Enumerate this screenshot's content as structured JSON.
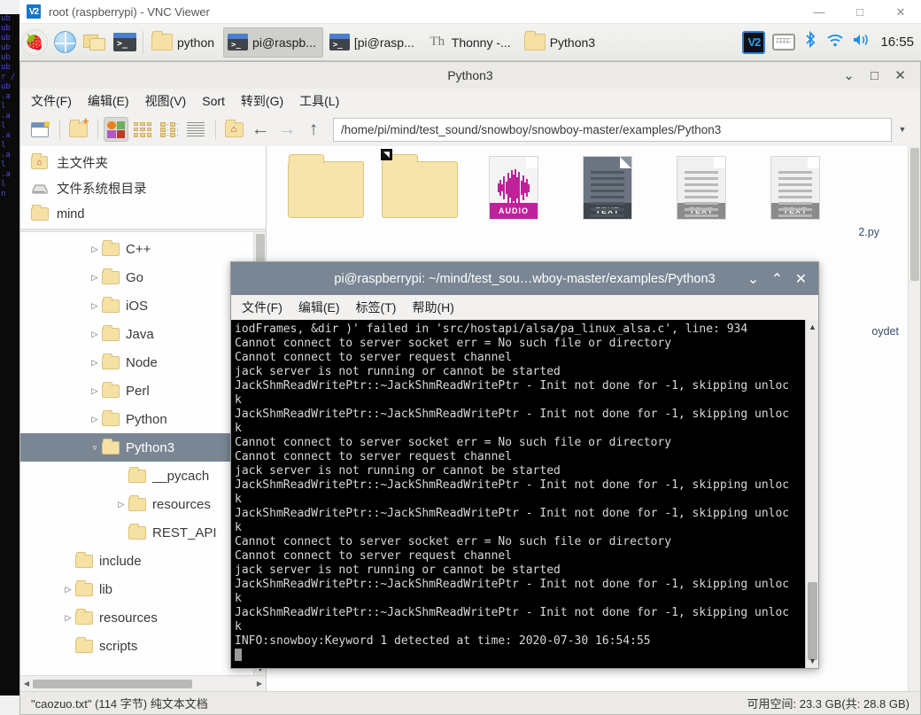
{
  "vnc": {
    "title": "root (raspberrypi) - VNC Viewer",
    "logo": "V2",
    "controls": {
      "minimize": "—",
      "maximize": "□",
      "close": "✕"
    },
    "control_names": [
      "minimize-icon",
      "maximize-icon",
      "close-icon"
    ]
  },
  "taskbar": {
    "launchers": [
      "raspberry-menu-icon",
      "web-browser-icon",
      "file-manager-icon",
      "terminal-icon"
    ],
    "raspberry_glyph": "🍓",
    "terminal_prompt": ">_",
    "tasks": [
      {
        "label": "python",
        "icon": "folder-icon",
        "active": false
      },
      {
        "label": "pi@raspb...",
        "icon": "terminal-icon",
        "active": true
      },
      {
        "label": "[pi@rasp...",
        "icon": "terminal-icon",
        "active": false
      },
      {
        "label": "Thonny -...",
        "icon": "thonny-icon",
        "active": false
      },
      {
        "label": "Python3",
        "icon": "folder-icon",
        "active": false
      }
    ],
    "thonny_glyph": "Th",
    "tray": {
      "vnc": "V2",
      "keyboard": "keyboard-icon",
      "bluetooth": "✱",
      "wifi": "wifi-icon",
      "volume": "volume-icon",
      "clock": "16:55"
    },
    "accent_blue": "#1e90e8"
  },
  "file_manager": {
    "title": "Python3",
    "controls": {
      "shade": "⌄",
      "maximize": "□",
      "close": "✕"
    },
    "menus": [
      "文件(F)",
      "编辑(E)",
      "视图(V)",
      "Sort",
      "转到(G)",
      "工具(L)"
    ],
    "toolbar": {
      "new_tab": "new-tab-icon",
      "new_folder": "new-folder-icon",
      "view_mode_icons": "icon-view-icon",
      "thumbnail_view": "thumbnail-view-icon",
      "compact_view": "compact-view-icon",
      "detailed_view": "detailed-list-view-icon",
      "home": "home-folder-icon",
      "back": "←",
      "forward": "→",
      "up": "↑",
      "dropdown": "▼"
    },
    "path": "/home/pi/mind/test_sound/snowboy/snowboy-master/examples/Python3",
    "places": [
      {
        "label": "主文件夹",
        "icon": "home-icon"
      },
      {
        "label": "文件系统根目录",
        "icon": "drive-icon"
      },
      {
        "label": "mind",
        "icon": "folder-icon"
      }
    ],
    "tree": [
      {
        "label": "C++",
        "indent": 2,
        "twisty": "▷",
        "selected": false
      },
      {
        "label": "Go",
        "indent": 2,
        "twisty": "▷",
        "selected": false
      },
      {
        "label": "iOS",
        "indent": 2,
        "twisty": "▷",
        "selected": false
      },
      {
        "label": "Java",
        "indent": 2,
        "twisty": "▷",
        "selected": false
      },
      {
        "label": "Node",
        "indent": 2,
        "twisty": "▷",
        "selected": false
      },
      {
        "label": "Perl",
        "indent": 2,
        "twisty": "▷",
        "selected": false
      },
      {
        "label": "Python",
        "indent": 2,
        "twisty": "▷",
        "selected": false
      },
      {
        "label": "Python3",
        "indent": 2,
        "twisty": "▿",
        "selected": true
      },
      {
        "label": "__pycach",
        "indent": 3,
        "twisty": "",
        "selected": false
      },
      {
        "label": "resources",
        "indent": 3,
        "twisty": "▷",
        "selected": false
      },
      {
        "label": "REST_API",
        "indent": 3,
        "twisty": "",
        "selected": false
      },
      {
        "label": "include",
        "indent": 1,
        "twisty": "",
        "selected": false
      },
      {
        "label": "lib",
        "indent": 1,
        "twisty": "▷",
        "selected": false
      },
      {
        "label": "resources",
        "indent": 1,
        "twisty": "▷",
        "selected": false
      },
      {
        "label": "scripts",
        "indent": 1,
        "twisty": "",
        "selected": false
      }
    ],
    "items": [
      {
        "label": "",
        "type": "folder",
        "badge": ""
      },
      {
        "label": "",
        "type": "folder",
        "badge": ""
      },
      {
        "label": "",
        "type": "audio",
        "badge": "AUDIO"
      },
      {
        "label": "",
        "type": "text-dark",
        "badge": "TEXT"
      },
      {
        "label": "",
        "type": "text",
        "badge": "TEXT"
      },
      {
        "label": "",
        "type": "text",
        "badge": "TEXT"
      }
    ],
    "partial_labels": {
      "py_file": "2.py",
      "snowboy_det": "oydet"
    },
    "status_left": "\"caozuo.txt\" (114 字节) 纯文本文档",
    "status_right": "可用空间: 23.3 GB(共: 28.8 GB)"
  },
  "terminal": {
    "title": "pi@raspberrypi: ~/mind/test_sou…wboy-master/examples/Python3",
    "controls": {
      "shade": "⌄",
      "maximize": "⌃",
      "close": "✕"
    },
    "menus": [
      "文件(F)",
      "编辑(E)",
      "标签(T)",
      "帮助(H)"
    ],
    "lines": [
      "iodFrames, &dir )' failed in 'src/hostapi/alsa/pa_linux_alsa.c', line: 934",
      "Cannot connect to server socket err = No such file or directory",
      "Cannot connect to server request channel",
      "jack server is not running or cannot be started",
      "JackShmReadWritePtr::~JackShmReadWritePtr - Init not done for -1, skipping unloc",
      "k",
      "JackShmReadWritePtr::~JackShmReadWritePtr - Init not done for -1, skipping unloc",
      "k",
      "Cannot connect to server socket err = No such file or directory",
      "Cannot connect to server request channel",
      "jack server is not running or cannot be started",
      "JackShmReadWritePtr::~JackShmReadWritePtr - Init not done for -1, skipping unloc",
      "k",
      "JackShmReadWritePtr::~JackShmReadWritePtr - Init not done for -1, skipping unloc",
      "k",
      "Cannot connect to server socket err = No such file or directory",
      "Cannot connect to server request channel",
      "jack server is not running or cannot be started",
      "JackShmReadWritePtr::~JackShmReadWritePtr - Init not done for -1, skipping unloc",
      "k",
      "JackShmReadWritePtr::~JackShmReadWritePtr - Init not done for -1, skipping unloc",
      "k",
      "INFO:snowboy:Keyword 1 detected at time: 2020-07-30 16:54:55"
    ],
    "background": "#000000",
    "foreground": "#d8d8d8",
    "titlebar_color": "#7a8694"
  },
  "background_terminal_sliver": {
    "lines": [
      "ub",
      "ub",
      "ub",
      "ub",
      "ub",
      "ub",
      "r /",
      "ub",
      ".a",
      "l",
      ".a",
      "l",
      ".a",
      "l",
      ".a",
      "l",
      ".a",
      "l",
      "n"
    ]
  }
}
